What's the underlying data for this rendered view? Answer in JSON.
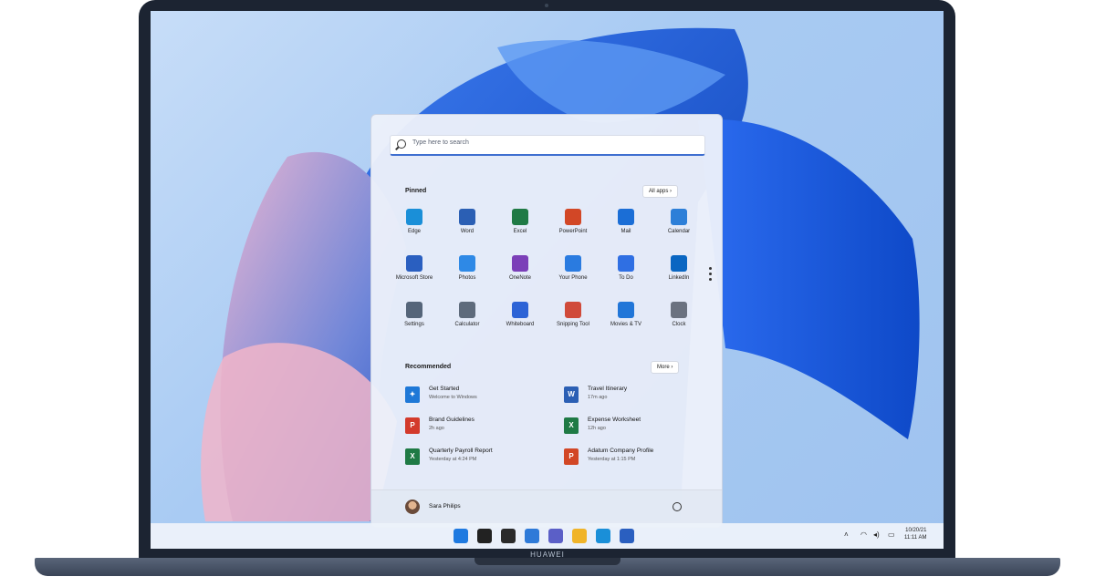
{
  "device": {
    "brand": "HUAWEI"
  },
  "start_menu": {
    "search_placeholder": "Type here to search",
    "pinned": {
      "title": "Pinned",
      "all_apps_label": "All apps",
      "apps": [
        {
          "label": "Edge",
          "icon": "edge-icon",
          "color": "#1a8fd8"
        },
        {
          "label": "Word",
          "icon": "word-icon",
          "color": "#2b5fb4"
        },
        {
          "label": "Excel",
          "icon": "excel-icon",
          "color": "#1f7a45"
        },
        {
          "label": "PowerPoint",
          "icon": "powerpoint-icon",
          "color": "#d24726"
        },
        {
          "label": "Mail",
          "icon": "mail-icon",
          "color": "#1b6ed6"
        },
        {
          "label": "Calendar",
          "icon": "calendar-icon",
          "color": "#2d7fd8"
        },
        {
          "label": "Microsoft Store",
          "icon": "store-icon",
          "color": "#2a5fc0"
        },
        {
          "label": "Photos",
          "icon": "photos-icon",
          "color": "#2e89e6"
        },
        {
          "label": "OneNote",
          "icon": "onenote-icon",
          "color": "#7b3fb8"
        },
        {
          "label": "Your Phone",
          "icon": "phone-icon",
          "color": "#2a7be0"
        },
        {
          "label": "To Do",
          "icon": "todo-icon",
          "color": "#2f6fe3"
        },
        {
          "label": "LinkedIn",
          "icon": "linkedin-icon",
          "color": "#0a66c2"
        },
        {
          "label": "Settings",
          "icon": "gear-icon",
          "color": "#55657a"
        },
        {
          "label": "Calculator",
          "icon": "calculator-icon",
          "color": "#5e6b7c"
        },
        {
          "label": "Whiteboard",
          "icon": "whiteboard-icon",
          "color": "#2c63d6"
        },
        {
          "label": "Snipping Tool",
          "icon": "snipping-icon",
          "color": "#d04a3a"
        },
        {
          "label": "Movies & TV",
          "icon": "movies-icon",
          "color": "#2176d8"
        },
        {
          "label": "Clock",
          "icon": "clock-icon",
          "color": "#6b7280"
        }
      ]
    },
    "recommended": {
      "title": "Recommended",
      "more_label": "More",
      "items": [
        {
          "name": "Get Started",
          "time": "Welcome to Windows",
          "icon": "get-started-icon",
          "color": "#1e78d7",
          "glyph": "✦"
        },
        {
          "name": "Travel Itinerary",
          "time": "17m ago",
          "icon": "word-doc-icon",
          "color": "#2b5fb4",
          "glyph": "W"
        },
        {
          "name": "Brand Guidelines",
          "time": "2h ago",
          "icon": "pdf-icon",
          "color": "#d33a2c",
          "glyph": "P"
        },
        {
          "name": "Expense Worksheet",
          "time": "12h ago",
          "icon": "excel-doc-icon",
          "color": "#1f7a45",
          "glyph": "X"
        },
        {
          "name": "Quarterly Payroll Report",
          "time": "Yesterday at 4:24 PM",
          "icon": "excel-doc-icon",
          "color": "#1f7a45",
          "glyph": "X"
        },
        {
          "name": "Adatum Company Profile",
          "time": "Yesterday at 1:15 PM",
          "icon": "powerpoint-doc-icon",
          "color": "#d24726",
          "glyph": "P"
        }
      ]
    },
    "user": {
      "name": "Sara Philips"
    }
  },
  "taskbar": {
    "icons": [
      {
        "icon": "start-icon",
        "color": "#1f7ae0"
      },
      {
        "icon": "search-icon",
        "color": "#222222"
      },
      {
        "icon": "task-view-icon",
        "color": "#2a2a2a"
      },
      {
        "icon": "widgets-icon",
        "color": "#2e7ad8"
      },
      {
        "icon": "chat-icon",
        "color": "#5b5fc7"
      },
      {
        "icon": "file-explorer-icon",
        "color": "#f0b429"
      },
      {
        "icon": "edge-icon",
        "color": "#1a8fd8"
      },
      {
        "icon": "store-icon",
        "color": "#2a5fc0"
      }
    ],
    "date": "10/20/21",
    "time": "11:11 AM"
  }
}
